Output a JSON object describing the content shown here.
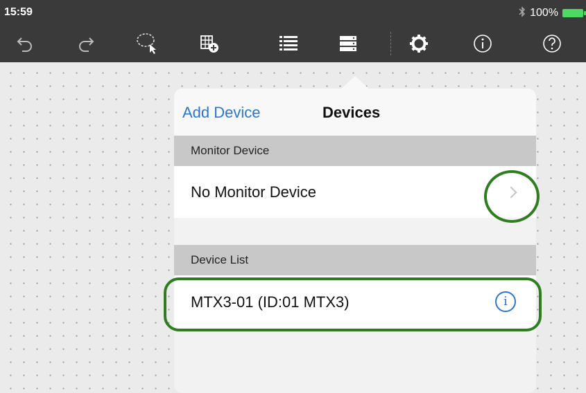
{
  "status_bar": {
    "time": "15:59",
    "bluetooth_icon": "bluetooth-icon",
    "battery_percent": "100%",
    "battery_level": 1.0
  },
  "toolbar": {
    "icons": [
      "undo-icon",
      "redo-icon",
      "lasso-select-icon",
      "add-grid-icon",
      "list-icon",
      "devices-icon",
      "settings-gear-icon",
      "info-icon",
      "help-icon"
    ]
  },
  "popover": {
    "add_device_label": "Add Device",
    "title": "Devices",
    "monitor_section": {
      "header": "Monitor Device",
      "value": "No Monitor Device"
    },
    "device_list_section": {
      "header": "Device List",
      "items": [
        {
          "label": "MTX3-01 (ID:01 MTX3)"
        }
      ]
    }
  },
  "colors": {
    "accent": "#2a76d2",
    "highlight": "#2e7d1f",
    "toolbar_bg": "#3a3a3a",
    "battery": "#4cd964"
  }
}
